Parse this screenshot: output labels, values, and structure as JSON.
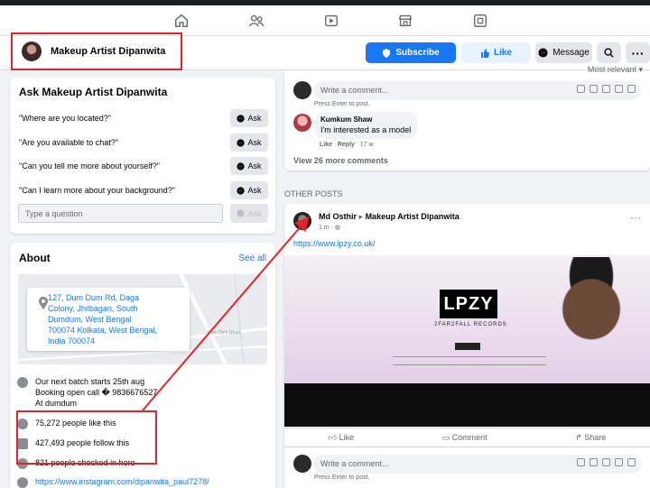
{
  "page": {
    "name": "Makeup Artist Dipanwita",
    "buttons": {
      "subscribe": "Subscribe",
      "like": "Like",
      "message": "Message"
    }
  },
  "ask": {
    "title": "Ask Makeup Artist Dipanwita",
    "questions": [
      "\"Where are you located?\"",
      "\"Are you available to chat?\"",
      "\"Can you tell me more about yourself?\"",
      "\"Can I learn more about your background?\""
    ],
    "ask_label": "Ask",
    "input_placeholder": "Type a question"
  },
  "about": {
    "title": "About",
    "see_all": "See all",
    "map_label": "Dum Dum Road",
    "address_lines": [
      "127, Dum Dum Rd, Daga",
      "Colony, Jhilbagan, South",
      "Dumdum, West Bengal",
      "700074 Kolkata, West Bengal,",
      "India 700074"
    ],
    "description_lines": [
      "Our next batch starts 25th aug",
      "Booking open call � 9836676527",
      "At dumdum"
    ],
    "likes": "75,272 people like this",
    "follows": "427,493 people follow this",
    "checkins": "821 people checked in here",
    "instagram": "https://www.instagram.com/dipanwita_paul7278/"
  },
  "comments": {
    "sort": "Most relevant",
    "input_placeholder": "Write a comment...",
    "press_enter": "Press Enter to post.",
    "item": {
      "author": "Kumkum Shaw",
      "text": "I'm interested as a model",
      "like": "Like",
      "reply": "Reply",
      "time": "17 w"
    },
    "view_more": "View 26 more comments"
  },
  "other_posts": {
    "heading": "OTHER POSTS",
    "post": {
      "author": "Md Osthir",
      "target": "Makeup Artist Dipanwita",
      "time": "1 m",
      "link": "https://www.lpzy.co.uk/",
      "image_logo": "LPZY",
      "image_subtitle": "2FAR2FALL RECORDS",
      "actions": [
        "Like",
        "Comment",
        "Share"
      ],
      "comment_placeholder": "Write a comment...",
      "press_enter": "Press Enter to post."
    }
  },
  "colors": {
    "accent": "#1877f2",
    "annotation_red": "#e3242b"
  }
}
